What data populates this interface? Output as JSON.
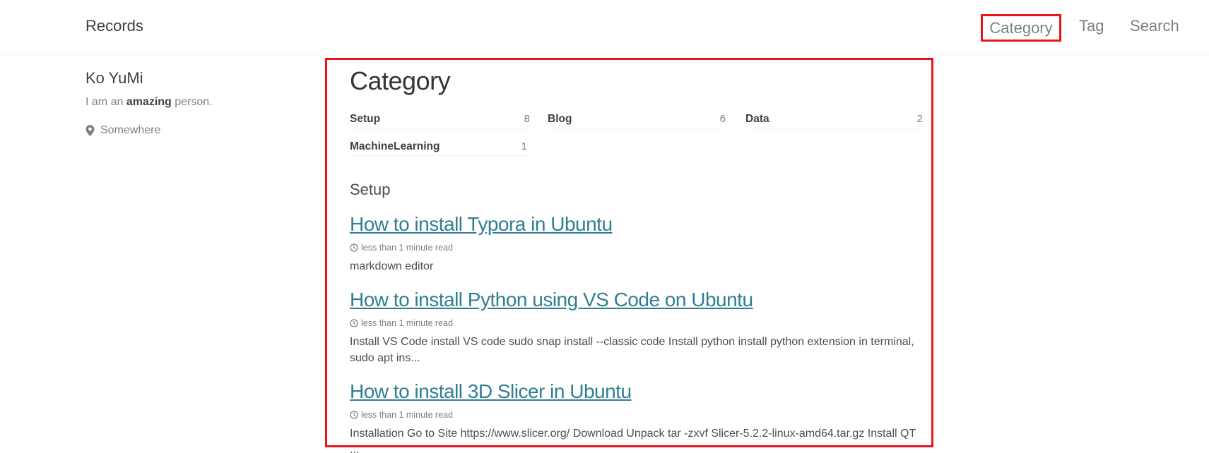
{
  "site": {
    "title": "Records"
  },
  "nav": [
    {
      "label": "Category"
    },
    {
      "label": "Tag"
    },
    {
      "label": "Search"
    }
  ],
  "author": {
    "name": "Ko YuMi",
    "bio_prefix": "I am an ",
    "bio_emphasis": "amazing",
    "bio_suffix": " person.",
    "location": "Somewhere",
    "location_icon": "map-marker-icon"
  },
  "page": {
    "title": "Category"
  },
  "taxonomy": [
    {
      "label": "Setup",
      "count": "8"
    },
    {
      "label": "Blog",
      "count": "6"
    },
    {
      "label": "Data",
      "count": "2"
    },
    {
      "label": "MachineLearning",
      "count": "1"
    }
  ],
  "section": {
    "heading": "Setup"
  },
  "posts": [
    {
      "title": "How to install Typora in Ubuntu",
      "meta": "less than 1 minute read",
      "excerpt": "markdown editor"
    },
    {
      "title": "How to install Python using VS Code on Ubuntu",
      "meta": "less than 1 minute read",
      "excerpt": "Install VS Code install VS code sudo snap install --classic code Install python install python extension in terminal, sudo apt ins..."
    },
    {
      "title": "How to install 3D Slicer in Ubuntu",
      "meta": "less than 1 minute read",
      "excerpt": "Installation Go to Site https://www.slicer.org/ Download Unpack tar -zxvf Slicer-5.2.2-linux-amd64.tar.gz Install QT ..."
    }
  ],
  "colors": {
    "highlight_border": "#e8141c",
    "link": "#2f7f93",
    "text": "#494e52",
    "muted": "#7a8288"
  }
}
